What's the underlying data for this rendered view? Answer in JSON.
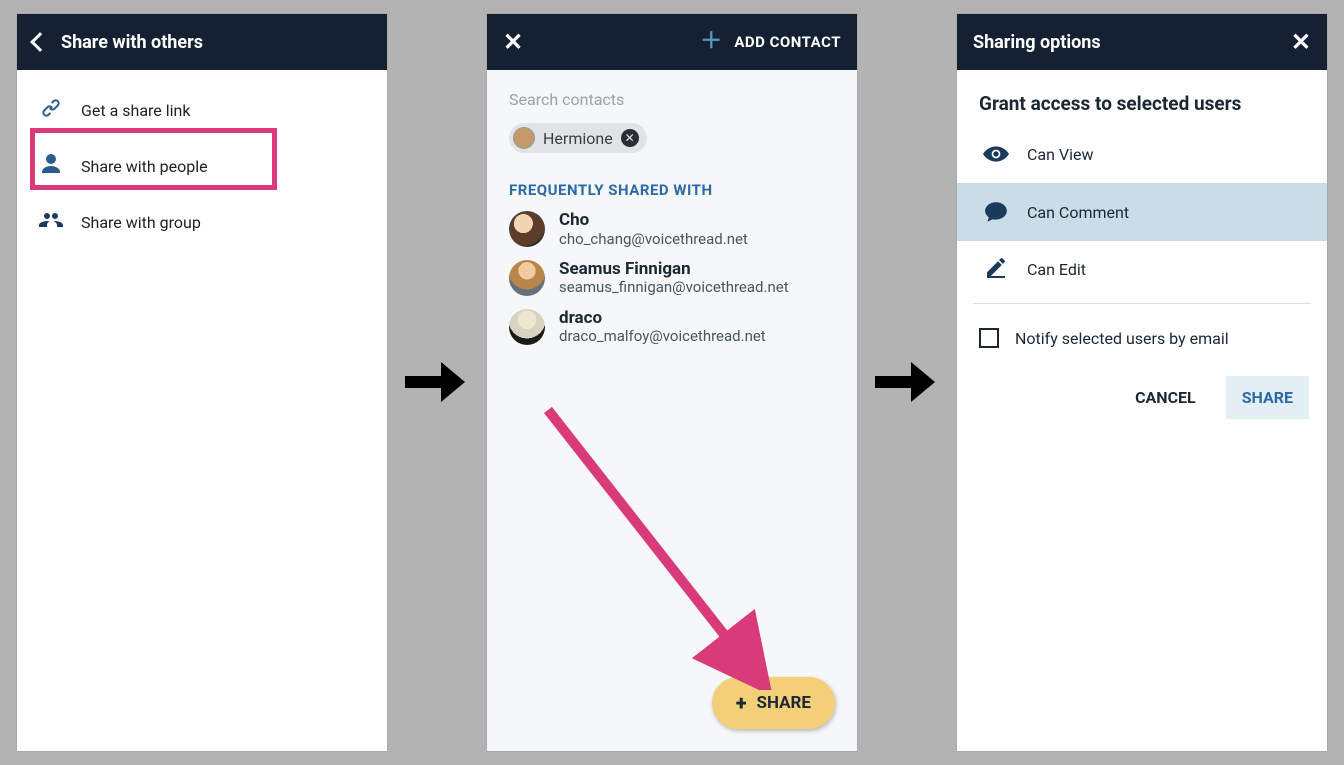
{
  "panel1": {
    "title": "Share with others",
    "items": [
      {
        "label": "Get a share link"
      },
      {
        "label": "Share with people"
      },
      {
        "label": "Share with group"
      }
    ]
  },
  "panel2": {
    "add_contact": "ADD CONTACT",
    "search_placeholder": "Search contacts",
    "chip_name": "Hermione",
    "section": "FREQUENTLY SHARED WITH",
    "contacts": [
      {
        "name": "Cho",
        "email": "cho_chang@voicethread.net"
      },
      {
        "name": "Seamus Finnigan",
        "email": "seamus_finnigan@voicethread.net"
      },
      {
        "name": "draco",
        "email": "draco_malfoy@voicethread.net"
      }
    ],
    "share_button": "SHARE"
  },
  "panel3": {
    "title": "Sharing options",
    "subtitle": "Grant access to selected users",
    "options": [
      {
        "label": "Can View"
      },
      {
        "label": "Can Comment"
      },
      {
        "label": "Can Edit"
      }
    ],
    "notify": "Notify selected users by email",
    "cancel": "CANCEL",
    "share": "SHARE"
  }
}
